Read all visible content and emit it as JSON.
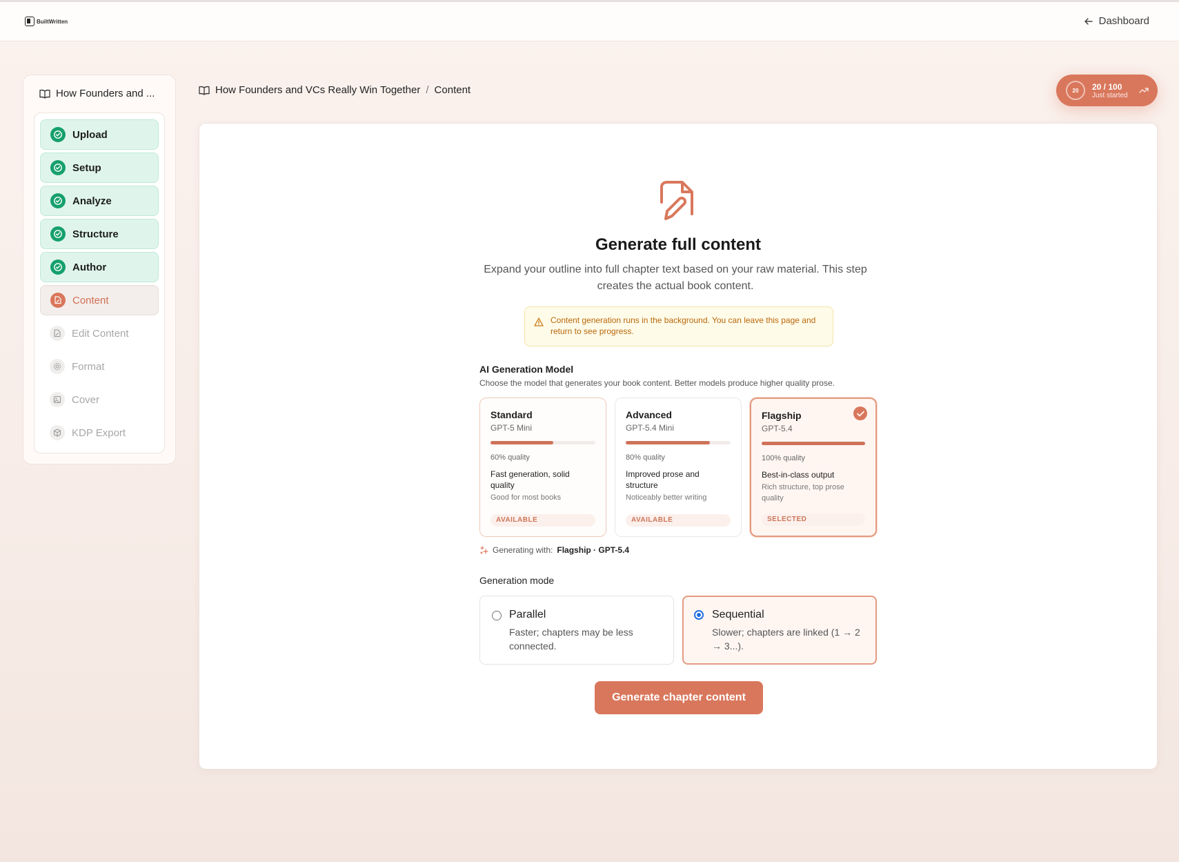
{
  "app": {
    "logo_text": "BuiltWritten"
  },
  "header": {
    "dashboard_label": "Dashboard"
  },
  "sidebar": {
    "title": "How Founders and ...",
    "steps": [
      {
        "label": "Upload",
        "state": "done"
      },
      {
        "label": "Setup",
        "state": "done"
      },
      {
        "label": "Analyze",
        "state": "done"
      },
      {
        "label": "Structure",
        "state": "done"
      },
      {
        "label": "Author",
        "state": "done"
      },
      {
        "label": "Content",
        "state": "active"
      },
      {
        "label": "Edit Content",
        "state": "todo"
      },
      {
        "label": "Format",
        "state": "todo"
      },
      {
        "label": "Cover",
        "state": "todo"
      },
      {
        "label": "KDP Export",
        "state": "todo"
      }
    ]
  },
  "breadcrumb": {
    "book": "How Founders and VCs Really Win Together",
    "separator": "/",
    "page": "Content"
  },
  "score": {
    "ring_value": "20",
    "value": "20 / 100",
    "label": "Just started"
  },
  "main": {
    "title": "Generate full content",
    "description": "Expand your outline into full chapter text based on your raw material. This step creates the actual book content.",
    "notice": "Content generation runs in the background. You can leave this page and return to see progress.",
    "model_section": {
      "title": "AI Generation Model",
      "subtitle": "Choose the model that generates your book content. Better models produce higher quality prose.",
      "models": [
        {
          "name": "Standard",
          "model": "GPT-5 Mini",
          "quality": 0.6,
          "quality_label": "60% quality",
          "headline": "Fast generation, solid quality",
          "sub": "Good for most books",
          "status": "AVAILABLE"
        },
        {
          "name": "Advanced",
          "model": "GPT-5.4 Mini",
          "quality": 0.8,
          "quality_label": "80% quality",
          "headline": "Improved prose and structure",
          "sub": "Noticeably better writing",
          "status": "AVAILABLE"
        },
        {
          "name": "Flagship",
          "model": "GPT-5.4",
          "quality": 1.0,
          "quality_label": "100% quality",
          "headline": "Best-in-class output",
          "sub": "Rich structure, top prose quality",
          "status": "SELECTED"
        }
      ]
    },
    "generating_with": {
      "label": "Generating with:",
      "value": "Flagship · GPT-5.4"
    },
    "mode_section": {
      "title": "Generation mode",
      "modes": [
        {
          "name": "Parallel",
          "desc": "Faster; chapters may be less connected.",
          "selected": false
        },
        {
          "name": "Sequential",
          "desc": "Slower; chapters are linked (1 → 2 → 3...).",
          "selected": true
        }
      ]
    },
    "generate_button": "Generate chapter content"
  },
  "colors": {
    "accent": "#d9775c",
    "done": "#16a06e",
    "done_bg": "#dff5ec",
    "notice_text": "#b9670a"
  }
}
